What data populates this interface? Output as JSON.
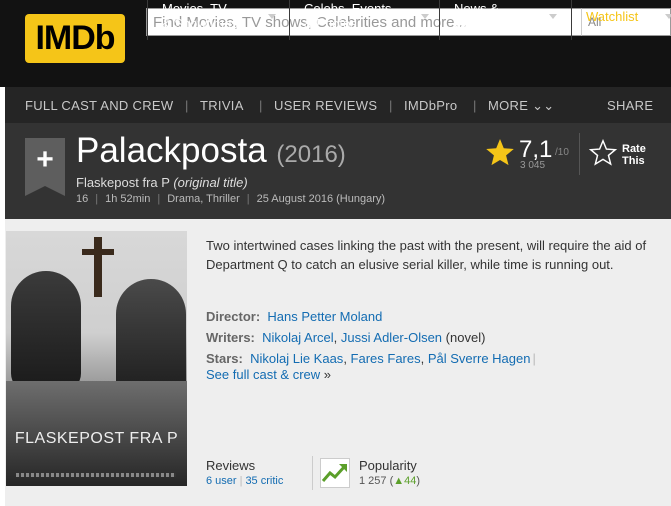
{
  "header": {
    "logo_text": "IMDb",
    "search_placeholder": "Find Movies, TV shows, Celebrities and more...",
    "search_category": "All",
    "nav": [
      {
        "label": "Movies, TV\n& Showtimes"
      },
      {
        "label": "Celebs, Events\n& Photos"
      },
      {
        "label": "News &\nCommunity"
      },
      {
        "label": "Watchlist"
      }
    ]
  },
  "subnav": {
    "items": [
      "FULL CAST AND CREW",
      "TRIVIA",
      "USER REVIEWS",
      "IMDbPro",
      "MORE ⌄⌄"
    ],
    "share": "SHARE"
  },
  "title": {
    "add_symbol": "+",
    "name": "Palackposta",
    "year": "(2016)",
    "original_title": "Flaskepost fra P",
    "original_title_note": "(original title)",
    "certificate": "16",
    "runtime": "1h 52min",
    "genres": "Drama, Thriller",
    "release": "25 August 2016 (Hungary)",
    "rating": "7,1",
    "rating_max": "/10",
    "rating_count": "3 045",
    "rate_label": "Rate\nThis"
  },
  "colors": {
    "brand": "#f5c518",
    "link": "#136cb2",
    "star": "#f5c518",
    "popularity_up": "#5b9f2a"
  },
  "main": {
    "poster_title": "FLASKEPOST FRA P",
    "summary": "Two intertwined cases linking the past with the present, will require the aid of Department Q to catch an elusive serial killer, while time is running out.",
    "director_label": "Director:",
    "director": "Hans Petter Moland",
    "writers_label": "Writers:",
    "writer1": "Nikolaj Arcel",
    "writer2": "Jussi Adler-Olsen",
    "writer2_note": "(novel)",
    "stars_label": "Stars:",
    "star1": "Nikolaj Lie Kaas",
    "star2": "Fares Fares",
    "star3": "Pål Sverre Hagen",
    "see_full": "See full cast & crew",
    "see_full_arrow": "»",
    "reviews_label": "Reviews",
    "user_reviews": "6 user",
    "critic_reviews": "35 critic",
    "popularity_label": "Popularity",
    "popularity_value": "1 257",
    "popularity_change": "44"
  }
}
